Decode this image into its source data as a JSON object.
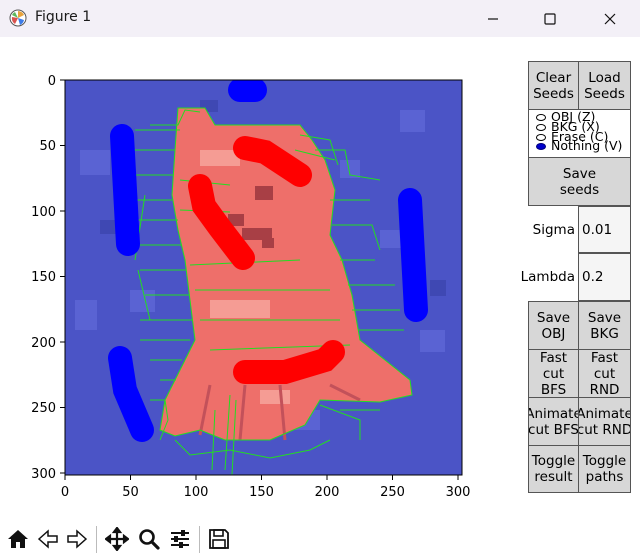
{
  "window": {
    "title": "Figure 1",
    "icons": [
      "matplotlib-icon",
      "minimize-icon",
      "maximize-icon",
      "close-icon"
    ]
  },
  "plot": {
    "xticks": [
      "0",
      "50",
      "100",
      "150",
      "200",
      "250",
      "300"
    ],
    "yticks": [
      "0",
      "50",
      "100",
      "150",
      "200",
      "250",
      "300"
    ],
    "colors": {
      "background_blue": "#4b54c6",
      "object_red": "#ee6f6a",
      "seed_obj": "#ff0000",
      "seed_bkg": "#0000ff",
      "boundary": "#22dd22"
    }
  },
  "panel": {
    "clear_seeds": "Clear\nSeeds",
    "load_seeds": "Load\nSeeds",
    "radio": [
      {
        "label": "OBJ (Z)",
        "selected": false
      },
      {
        "label": "BKG (X)",
        "selected": false
      },
      {
        "label": "Erase (C)",
        "selected": false
      },
      {
        "label": "Nothing (V)",
        "selected": true
      }
    ],
    "save_seeds": "Save\nseeds",
    "sigma_label": "Sigma",
    "sigma_value": "0.01",
    "lambda_label": "Lambda",
    "lambda_value": "0.2",
    "save_obj": "Save\nOBJ",
    "save_bkg": "Save\nBKG",
    "fast_cut_bfs": "Fast\ncut BFS",
    "fast_cut_rnd": "Fast\ncut RND",
    "animate_cut_bfs": "Animate\ncut BFS",
    "animate_cut_rnd": "Animate\ncut RND",
    "toggle_result": "Toggle\nresult",
    "toggle_paths": "Toggle\npaths"
  },
  "toolbar": {
    "icons": [
      "home-icon",
      "back-icon",
      "forward-icon",
      "pan-icon",
      "zoom-icon",
      "configure-subplots-icon",
      "save-icon"
    ]
  }
}
